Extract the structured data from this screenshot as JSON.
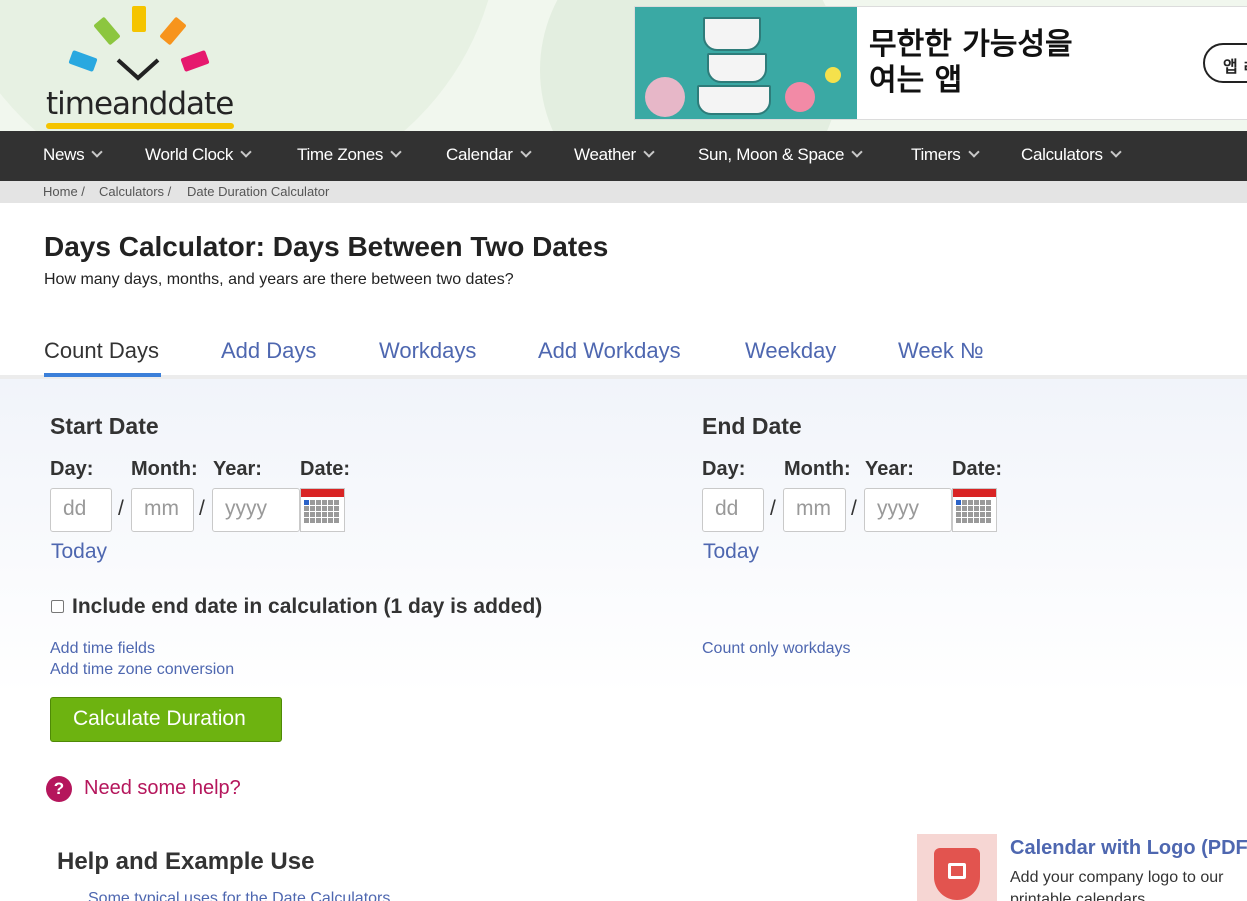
{
  "logo": {
    "text": "timeanddate"
  },
  "ad": {
    "text_line1": "무한한 가능성을",
    "text_line2": "여는 앱",
    "button": "앱 ㄹ"
  },
  "nav": {
    "items": [
      {
        "label": "News"
      },
      {
        "label": "World Clock"
      },
      {
        "label": "Time Zones"
      },
      {
        "label": "Calendar"
      },
      {
        "label": "Weather"
      },
      {
        "label": "Sun, Moon & Space"
      },
      {
        "label": "Timers"
      },
      {
        "label": "Calculators"
      }
    ]
  },
  "breadcrumb": {
    "items": [
      "Home /",
      "Calculators /",
      "Date Duration Calculator"
    ]
  },
  "page": {
    "title": "Days Calculator: Days Between Two Dates",
    "subtitle": "How many days, months, and years are there between two dates?"
  },
  "tabs": [
    {
      "label": "Count Days",
      "active": true
    },
    {
      "label": "Add Days"
    },
    {
      "label": "Workdays"
    },
    {
      "label": "Add Workdays"
    },
    {
      "label": "Weekday"
    },
    {
      "label": "Week №"
    }
  ],
  "form": {
    "start": {
      "heading": "Start Date",
      "day_label": "Day:",
      "month_label": "Month:",
      "year_label": "Year:",
      "date_label": "Date:",
      "day_placeholder": "dd",
      "month_placeholder": "mm",
      "year_placeholder": "yyyy",
      "today": "Today"
    },
    "end": {
      "heading": "End Date",
      "day_label": "Day:",
      "month_label": "Month:",
      "year_label": "Year:",
      "date_label": "Date:",
      "day_placeholder": "dd",
      "month_placeholder": "mm",
      "year_placeholder": "yyyy",
      "today": "Today"
    },
    "include_end_label": "Include end date in calculation (1 day is added)",
    "include_end_checked": false,
    "add_time_fields": "Add time fields",
    "add_time_zone": "Add time zone conversion",
    "count_workdays": "Count only workdays",
    "calculate": "Calculate Duration"
  },
  "help": {
    "icon": "?",
    "label": "Need some help?"
  },
  "help_section": {
    "heading": "Help and Example Use",
    "link": "Some typical uses for the Date Calculators"
  },
  "promo": {
    "title": "Calendar with Logo (PDF",
    "line1": "Add your company logo to our",
    "line2": "printable calendars"
  },
  "colors": {
    "nav_bg": "#323232",
    "link": "#4e67b0",
    "button": "#6db310",
    "help": "#b5165c",
    "tab_underline": "#3b7fd9"
  }
}
